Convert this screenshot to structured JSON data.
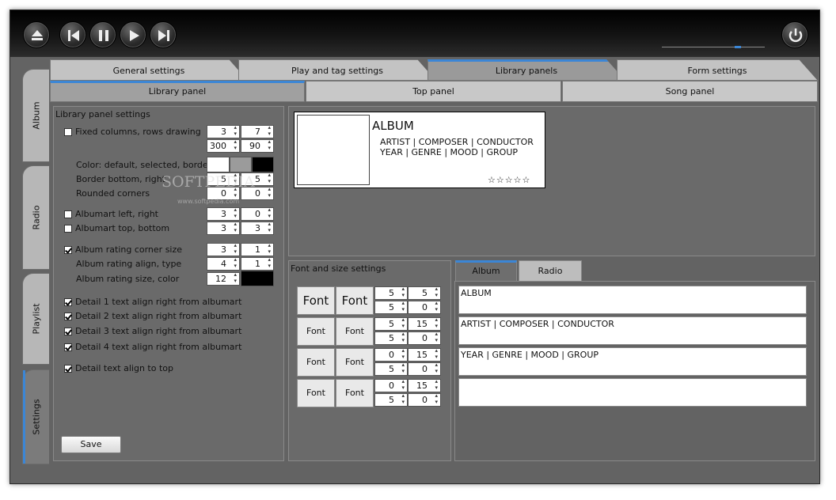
{
  "window": {
    "title": ""
  },
  "player": {
    "buttons": [
      {
        "name": "eject-icon"
      },
      {
        "name": "previous-icon"
      },
      {
        "name": "pause-icon"
      },
      {
        "name": "play-icon"
      },
      {
        "name": "next-icon"
      }
    ],
    "power": "power-icon",
    "volume": 0.75
  },
  "side_tabs": [
    "Album",
    "Radio",
    "Playlist",
    "Settings"
  ],
  "top_tabs": [
    "General settings",
    "Play and tag settings",
    "Library panels",
    "Form settings"
  ],
  "sub_tabs": [
    "Library panel",
    "Top panel",
    "Song panel"
  ],
  "left": {
    "title": "Library panel settings",
    "fixed": "Fixed columns, rows drawing",
    "fixed_v": [
      "3",
      "7",
      "300",
      "90"
    ],
    "color": "Color: default, selected, border",
    "border": "Border bottom, right",
    "border_v": [
      "5",
      "5"
    ],
    "rounded": "Rounded corners",
    "rounded_v": [
      "0",
      "0"
    ],
    "am_lr": "Albumart  left, right",
    "am_lr_v": [
      "3",
      "0"
    ],
    "am_tb": "Albumart top, bottom",
    "am_tb_v": [
      "3",
      "3"
    ],
    "rating_corner": "Album rating corner size",
    "rating_corner_v": [
      "3",
      "1"
    ],
    "rating_align": "Album rating align, type",
    "rating_align_v": [
      "4",
      "1"
    ],
    "rating_size": "Album rating size, color",
    "rating_size_v": "12",
    "detail1": "Detail 1 text align right from albumart",
    "detail2": "Detail 2 text align right from albumart",
    "detail3": "Detail 3 text align right from albumart",
    "detail4": "Detail 4 text align right from albumart",
    "detail_top": "Detail text align to top",
    "save": "Save"
  },
  "preview": {
    "title": "ALBUM",
    "line1": "ARTIST | COMPOSER | CONDUCTOR",
    "line2": "YEAR | GENRE | MOOD | GROUP",
    "stars": "☆☆☆☆☆"
  },
  "font_section": {
    "title": "Font and size settings",
    "font_label": "Font",
    "rows": [
      {
        "v": [
          "5",
          "5",
          "5",
          "0"
        ]
      },
      {
        "v": [
          "5",
          "15",
          "5",
          "0"
        ]
      },
      {
        "v": [
          "0",
          "15",
          "5",
          "0"
        ]
      },
      {
        "v": [
          "0",
          "15",
          "5",
          "0"
        ]
      }
    ]
  },
  "text_tabs": [
    "Album",
    "Radio"
  ],
  "text_fields": [
    "ALBUM",
    "ARTIST | COMPOSER | CONDUCTOR",
    "YEAR | GENRE | MOOD | GROUP",
    ""
  ],
  "watermark": {
    "line1": "SOFTPEDIA",
    "line2": "www.softpedia.com"
  }
}
